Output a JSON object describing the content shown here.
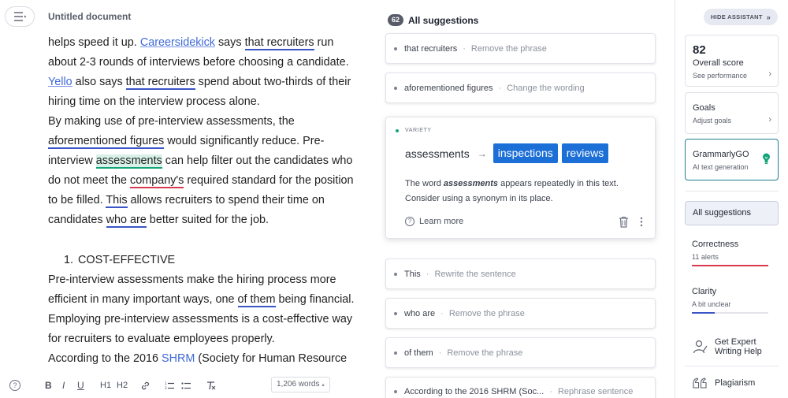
{
  "editor": {
    "title": "Untitled document",
    "p1": {
      "t1": "helps speed it up. ",
      "link1": "Careersidekick",
      "t2": " says ",
      "u1": "that recruiters",
      "t3": " run about 2-3 rounds of interviews before choosing a candidate. ",
      "link2": "Yello",
      "t4": " also says ",
      "u2": "that recruiters",
      "t5": " spend about two-thirds of their hiring time on the interview process alone."
    },
    "p2": {
      "t1": "By making use of pre-interview assessments, the ",
      "u1": "aforementioned figures",
      "t2": " would significantly reduce. Pre-interview ",
      "hl": "assessments",
      "t3": " can help filter out the candidates who do not meet the ",
      "r1": "company's",
      "t4": " required standard for the position to be filled. ",
      "u2": "This",
      "t5": " allows recruiters to spend their time on candidates ",
      "u3": "who are",
      "t6": " better suited for the job."
    },
    "list_num": "1.",
    "list_item": "COST-EFFECTIVE",
    "p3": {
      "t1": "Pre-interview assessments make the hiring process more efficient in many important ways, one ",
      "u1": "of them",
      "t2": " being financial. Employing pre-interview assessments is a cost-effective way for recruiters to evaluate employees properly."
    },
    "p4": {
      "t1": "According to the 2016 ",
      "link1": "SHRM",
      "t2": " (Society for Human Resource"
    },
    "word_count": "1,206 words",
    "word_count_chevron": "▴",
    "toolbar": {
      "help": "?",
      "bold": "B",
      "italic": "I",
      "underline": "U",
      "h1": "H1",
      "h2": "H2"
    }
  },
  "suggestions": {
    "count": "62",
    "title": "All suggestions",
    "separator": "·",
    "items": [
      {
        "text": "that recruiters",
        "action": "Remove the phrase"
      },
      {
        "text": "aforementioned figures",
        "action": "Change the wording"
      },
      {
        "text": "This",
        "action": "Rewrite the sentence"
      },
      {
        "text": "who are",
        "action": "Remove the phrase"
      },
      {
        "text": "of them",
        "action": "Remove the phrase"
      },
      {
        "text": "According to the 2016 SHRM (Soc...",
        "action": "Rephrase sentence"
      }
    ],
    "expanded": {
      "category": "VARIETY",
      "original": "assessments",
      "arrow": "→",
      "replacements": [
        "inspections",
        "reviews"
      ],
      "desc_pre": "The word ",
      "desc_word": "assessments",
      "desc_post": " appears repeatedly in this text. Consider using a synonym in its place.",
      "learn_more": "Learn more",
      "learn_icon": "?"
    }
  },
  "assistant": {
    "hide_label": "HIDE ASSISTANT",
    "hide_chevron": "»",
    "score": "82",
    "score_label": "Overall score",
    "score_link": "See performance",
    "chevron": "›",
    "goals_label": "Goals",
    "goals_link": "Adjust goals",
    "go_label": "GrammarlyGO",
    "go_link": "AI text generation",
    "all_suggestions": "All suggestions",
    "correctness": {
      "label": "Correctness",
      "sub": "11 alerts",
      "level": 1.0,
      "color": "#d83a52"
    },
    "clarity": {
      "label": "Clarity",
      "sub": "A bit unclear",
      "level": 0.3,
      "color": "#3b55c7"
    },
    "expert_label": "Get Expert\nWriting Help",
    "expert_line1": "Get Expert",
    "expert_line2": "Writing Help",
    "plagiarism_label": "Plagiarism"
  },
  "colors": {
    "accent_blue": "#1c6fd6",
    "underline_blue": "#3b55c7",
    "underline_red": "#d83a52",
    "variety_green": "#15a37a"
  }
}
